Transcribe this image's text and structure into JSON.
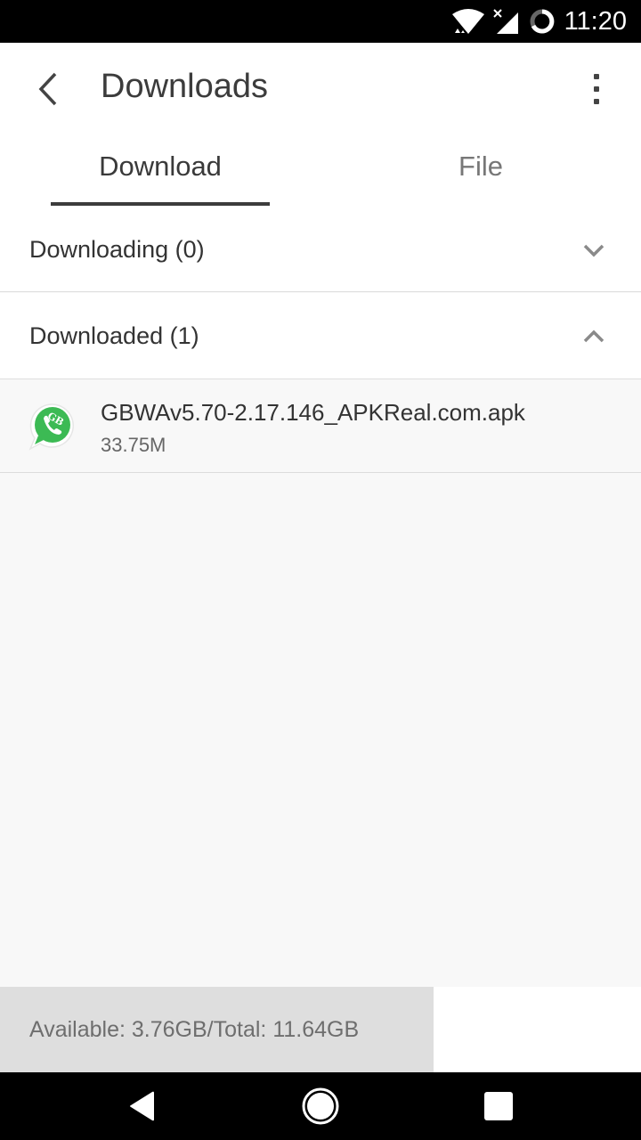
{
  "status_bar": {
    "time": "11:20",
    "icons": [
      "wifi-icon",
      "signal-no-sim-icon",
      "sync-progress-icon"
    ]
  },
  "app_bar": {
    "title": "Downloads",
    "back_icon": "chevron-left-icon",
    "menu_icon": "more-vert-icon"
  },
  "tabs": [
    {
      "label": "Download",
      "selected": true
    },
    {
      "label": "File",
      "selected": false
    }
  ],
  "sections": [
    {
      "label": "Downloading (0)",
      "expanded": false,
      "icon": "chevron-down-icon"
    },
    {
      "label": "Downloaded (1)",
      "expanded": true,
      "icon": "chevron-up-icon",
      "items": [
        {
          "name": "GBWAv5.70-2.17.146_APKReal.com.apk",
          "size": "33.75M",
          "icon": "gbwhatsapp-app-icon"
        }
      ]
    }
  ],
  "storage": {
    "text": "Available: 3.76GB/Total: 11.64GB",
    "available_gb": 3.76,
    "total_gb": 11.64,
    "used_fraction": 0.677
  },
  "nav_bar": {
    "buttons": [
      "back",
      "home",
      "recents"
    ]
  },
  "colors": {
    "accent_whatsapp": "#3cba54",
    "tab_indicator": "#3c3c3c",
    "storage_fill": "#dedede"
  }
}
